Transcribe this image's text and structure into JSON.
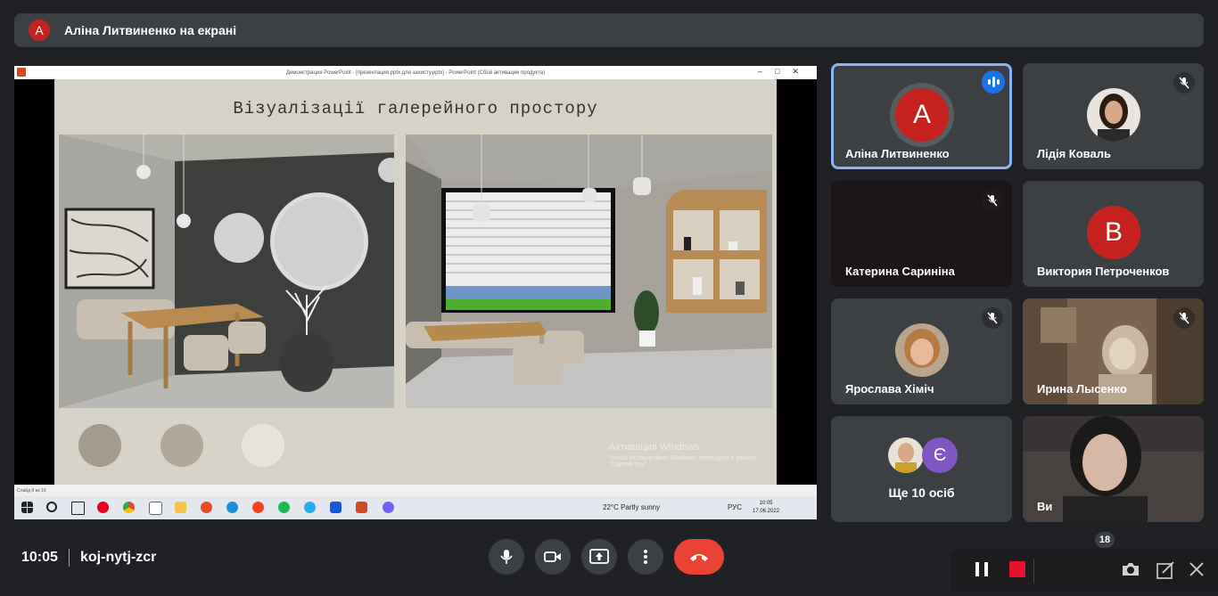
{
  "banner": {
    "avatar_letter": "А",
    "text": "Аліна Литвиненко на екрані"
  },
  "shared_screen": {
    "window_title": "Демонстрация PowerPoint - [презентация.pptx для захисту.pptx] - PowerPoint (Сбой активации продукта)",
    "slide": {
      "title": "Візуалізації галерейного простору",
      "swatch_colors": [
        "#a49b8f",
        "#b1a89a",
        "#e8e3dc"
      ]
    },
    "activation": {
      "title": "Активация Windows",
      "subtitle": "Чтобы активировать Windows, перейдите в раздел \"Параметры\"."
    },
    "status_bar": {
      "slide_counter": "Слайд 8 из 16"
    },
    "taskbar": {
      "weather": "22°C  Partly sunny",
      "lang": "РУС",
      "time": "10:05",
      "date": "17.06.2022"
    }
  },
  "participants": [
    {
      "name": "Аліна Литвиненко",
      "avatar": "А",
      "color": "#c5221f",
      "speaking": true
    },
    {
      "name": "Лідія Коваль",
      "avatar": "photo",
      "muted": true
    },
    {
      "name": "Катерина Сариніна",
      "muted": true
    },
    {
      "name": "Виктория Петроченков",
      "avatar": "В",
      "color": "#c5221f"
    },
    {
      "name": "Ярослава Хіміч",
      "avatar": "photo",
      "muted": true
    },
    {
      "name": "Ирина Лысенко",
      "muted": true
    },
    {
      "more_label": "Ще 10 осіб",
      "avatar_letter": "Є",
      "avatar_color": "#7e57c2"
    },
    {
      "name": "Ви"
    }
  ],
  "controls": {
    "time": "10:05",
    "meeting_code": "koj-nytj-zcr",
    "participant_count": "18"
  }
}
